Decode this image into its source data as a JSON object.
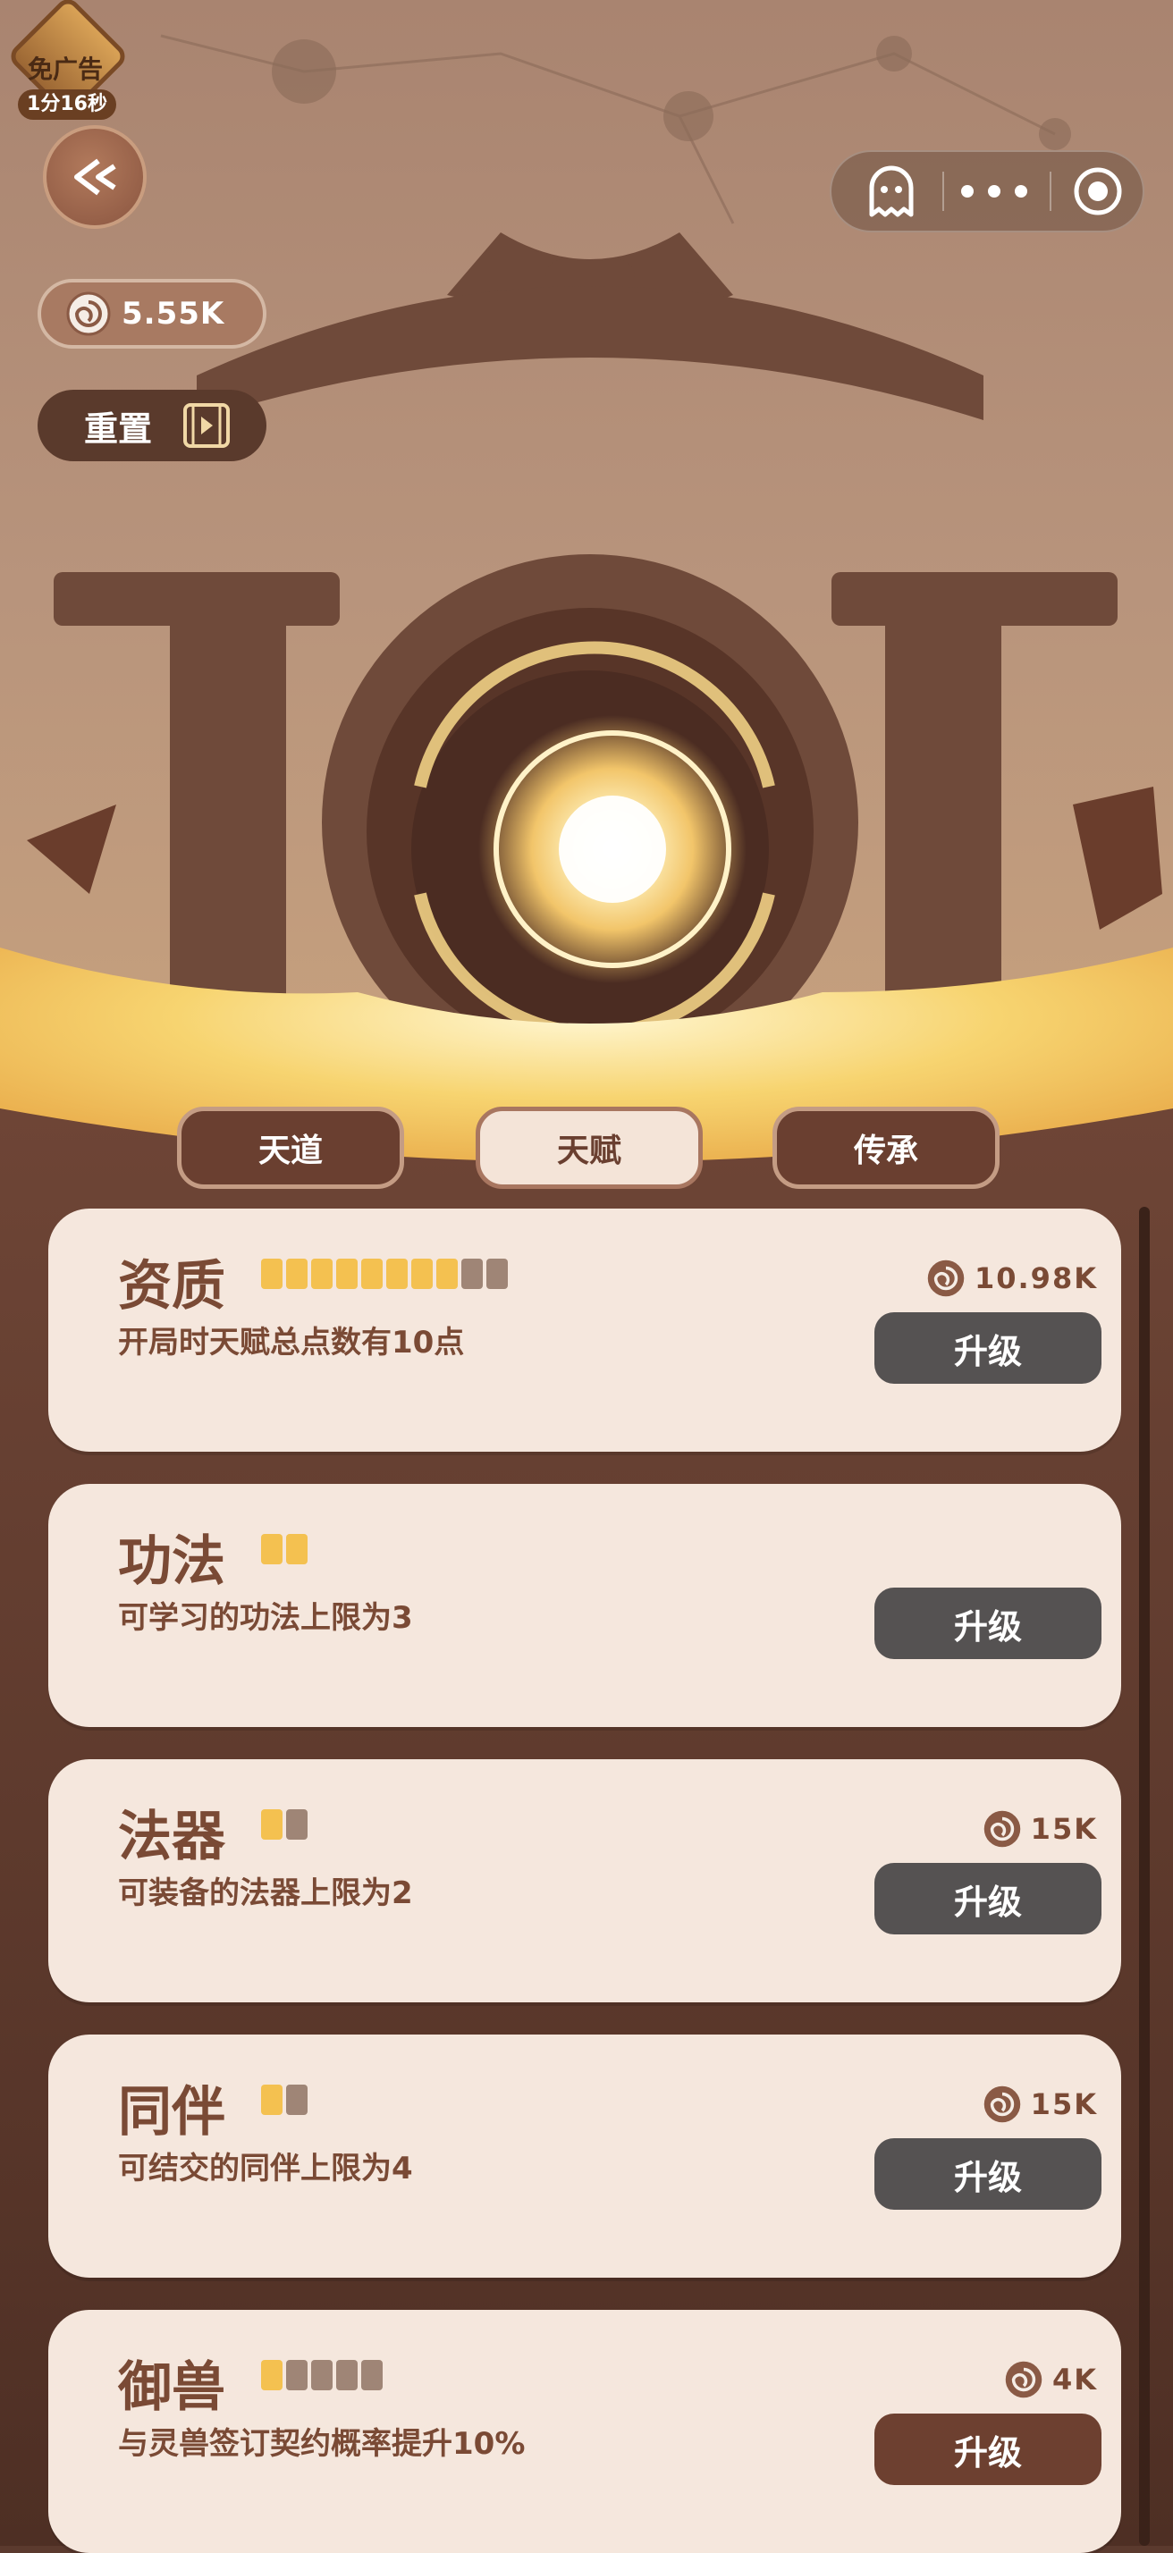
{
  "ad_badge": {
    "label": "免广告",
    "timer": "1分16秒"
  },
  "currency": {
    "value": "5.55K",
    "icon": "spiral-coin-icon"
  },
  "reset": {
    "label": "重置",
    "icon": "video-icon"
  },
  "capsule": {
    "icons": [
      "ghost-icon",
      "more-icon",
      "record-icon"
    ]
  },
  "tabs": [
    {
      "label": "天道",
      "active": false
    },
    {
      "label": "天赋",
      "active": true
    },
    {
      "label": "传承",
      "active": false
    }
  ],
  "items": [
    {
      "title": "资质",
      "levels_filled": 8,
      "levels_total": 10,
      "description": "开局时天赋总点数有10点",
      "cost": "10.98K",
      "button": "升级",
      "button_color": "#555252"
    },
    {
      "title": "功法",
      "levels_filled": 2,
      "levels_total": 2,
      "description": "可学习的功法上限为3",
      "cost": "",
      "button": "升级",
      "button_color": "#555252"
    },
    {
      "title": "法器",
      "levels_filled": 1,
      "levels_total": 2,
      "description": "可装备的法器上限为2",
      "cost": "15K",
      "button": "升级",
      "button_color": "#555252"
    },
    {
      "title": "同伴",
      "levels_filled": 1,
      "levels_total": 2,
      "description": "可结交的同伴上限为4",
      "cost": "15K",
      "button": "升级",
      "button_color": "#555252"
    },
    {
      "title": "御兽",
      "levels_filled": 1,
      "levels_total": 5,
      "description": "与灵兽签订契约概率提升10%",
      "cost": "4K",
      "button": "升级",
      "button_color": "#6d4030"
    }
  ]
}
